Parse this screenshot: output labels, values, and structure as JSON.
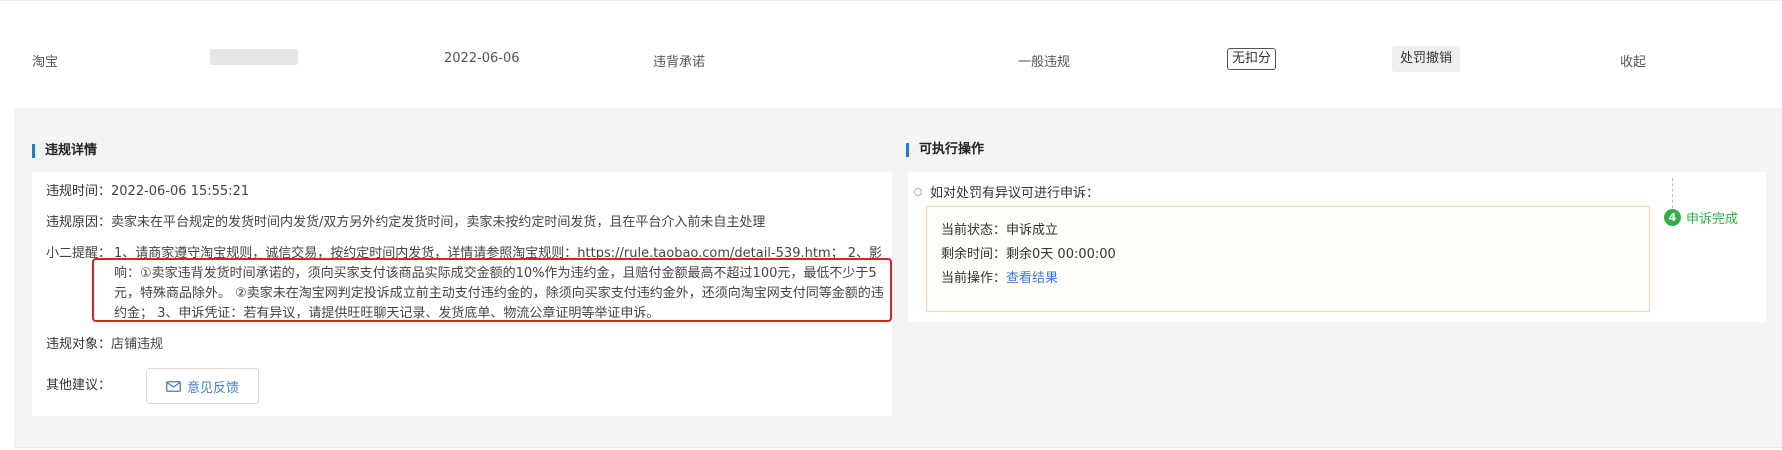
{
  "summary": {
    "platform": "淘宝",
    "date": "2022-06-06",
    "violation_type": "违背承诺",
    "severity": "一般违规",
    "deduction_tag": "无扣分",
    "status_tag": "处罚撤销",
    "collapse_label": "收起"
  },
  "details": {
    "title": "违规详情",
    "time_label": "违规时间：",
    "time_value": "2022-06-06 15:55:21",
    "reason_label": "违规原因：",
    "reason_value": "卖家未在平台规定的发货时间内发货/双方另外约定发货时间，卖家未按约定时间发货，且在平台介入前未自主处理",
    "reminder_label": "小二提醒：",
    "reminder_value": "1、请商家遵守淘宝规则，诚信交易，按约定时间内发货，详情请参照淘宝规则：https://rule.taobao.com/detail-539.htm； 2、影响：①卖家违背发货时间承诺的，须向买家支付该商品实际成交金额的10%作为违约金，且赔付金额最高不超过100元，最低不少于5元，特殊商品除外。 ②卖家未在淘宝网判定投诉成立前主动支付违约金的，除须向买家支付违约金外，还须向淘宝网支付同等金额的违约金； 3、申诉凭证：若有异议，请提供旺旺聊天记录、发货底单、物流公章证明等举证申诉。",
    "target_label": "违规对象：",
    "target_value": "店铺违规",
    "suggest_label": "其他建议：",
    "feedback_label": "意见反馈"
  },
  "actions": {
    "title": "可执行操作",
    "appeal_prompt": "如对处罚有异议可进行申诉：",
    "status_label": "当前状态：",
    "status_value": "申诉成立",
    "remaining_label": "剩余时间：",
    "remaining_value": "剩余0天 00:00:00",
    "operation_label": "当前操作：",
    "operation_link": "查看结果",
    "step_number": "4",
    "step_label": "申诉完成"
  },
  "colors": {
    "accent_blue": "#3b7ddd",
    "success_green": "#2fb046",
    "highlight_red": "#d7261e"
  }
}
